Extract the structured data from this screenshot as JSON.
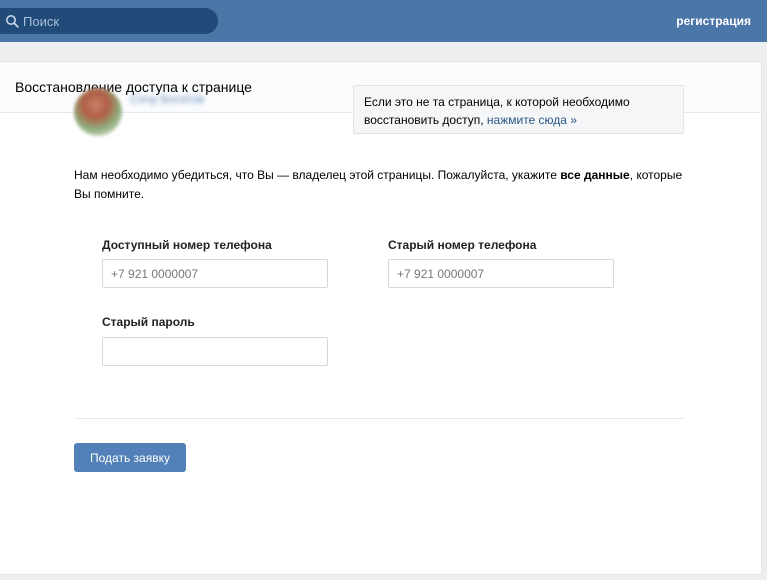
{
  "topbar": {
    "search_placeholder": "Поиск",
    "register_label": "регистрация"
  },
  "card": {
    "title": "Восстановление доступа к странице"
  },
  "profile": {
    "name": "Сочу Богатов"
  },
  "info_box": {
    "text": "Если это не та страница, к которой необходимо восстановить доступ,",
    "link": "нажмите сюда »"
  },
  "intro": {
    "text_before": "Нам необходимо убедиться, что Вы — владелец этой страницы. Пожалуйста, укажите",
    "bold": "все данные",
    "text_after": ", которые Вы помните."
  },
  "form": {
    "phone_label": "Доступный номер телефона",
    "phone_placeholder": "+7 921 0000007",
    "old_phone_label": "Старый номер телефона",
    "old_phone_placeholder": "+7 921 0000007",
    "old_password_label": "Старый пароль",
    "submit_label": "Подать заявку"
  },
  "colors": {
    "header": "#4a76a8",
    "button": "#5181b8",
    "link": "#2a5885"
  }
}
